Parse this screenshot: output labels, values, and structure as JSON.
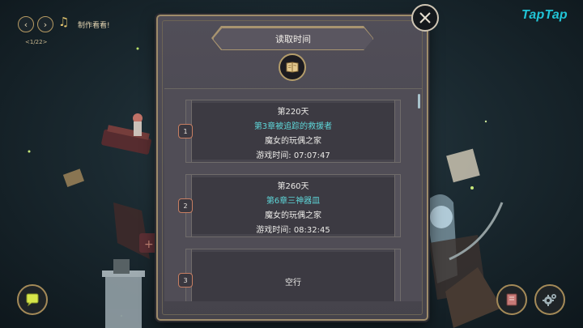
{
  "music_player": {
    "prev_icon": "chevron-left-icon",
    "next_icon": "chevron-right-icon",
    "note_icon": "music-note-icon",
    "title": "制作看看!",
    "track_counter": "<1/22>"
  },
  "logo_text": "TapTap",
  "dialog": {
    "title": "读取时间",
    "badge_icon": "open-book-icon",
    "close_icon": "close-icon",
    "slots": [
      {
        "number": "1",
        "day": "第220天",
        "chapter": "第3章被追踪的救援者",
        "place": "魔女的玩偶之家",
        "play_time": "游戏时间:  07:07:47"
      },
      {
        "number": "2",
        "day": "第260天",
        "chapter": "第6章三神器皿",
        "place": "魔女的玩偶之家",
        "play_time": "游戏时间:  08:32:45"
      },
      {
        "number": "3",
        "empty_label": "空行"
      }
    ]
  },
  "bottom_buttons": {
    "left_icon": "chat-bubble-icon",
    "right_icons": [
      "save-book-icon",
      "gear-icon"
    ]
  },
  "colors": {
    "chapter_text": "#5ed7d9",
    "logo": "#21c4d6",
    "gold_border": "#a89470"
  }
}
